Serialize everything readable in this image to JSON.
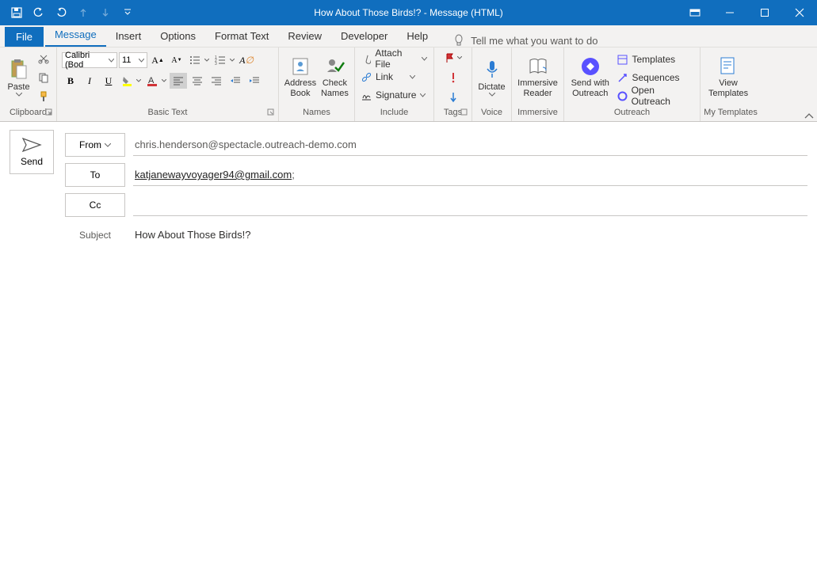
{
  "title": "How About Those Birds!?  -  Message (HTML)",
  "tabs": {
    "file": "File",
    "message": "Message",
    "insert": "Insert",
    "options": "Options",
    "format": "Format Text",
    "review": "Review",
    "developer": "Developer",
    "help": "Help",
    "tellme": "Tell me what you want to do"
  },
  "ribbon": {
    "clipboard": {
      "paste": "Paste",
      "label": "Clipboard"
    },
    "basicText": {
      "font": "Calibri (Bod",
      "size": "11",
      "label": "Basic Text"
    },
    "names": {
      "address": "Address\nBook",
      "check": "Check\nNames",
      "label": "Names"
    },
    "include": {
      "attach": "Attach File",
      "link": "Link",
      "signature": "Signature",
      "label": "Include"
    },
    "tags": {
      "label": "Tags"
    },
    "voice": {
      "dictate": "Dictate",
      "label": "Voice"
    },
    "immersive": {
      "reader": "Immersive\nReader",
      "label": "Immersive"
    },
    "outreach": {
      "send": "Send with\nOutreach",
      "templates": "Templates",
      "sequences": "Sequences",
      "open": "Open Outreach",
      "label": "Outreach"
    },
    "myTemplates": {
      "view": "View\nTemplates",
      "label": "My Templates"
    }
  },
  "compose": {
    "send": "Send",
    "from": "From",
    "fromValue": "chris.henderson@spectacle.outreach-demo.com",
    "to": "To",
    "toValue": "katjanewayvoyager94@gmail.com",
    "toSuffix": ";",
    "cc": "Cc",
    "ccValue": "",
    "subject": "Subject",
    "subjectValue": "How About Those Birds!?"
  }
}
